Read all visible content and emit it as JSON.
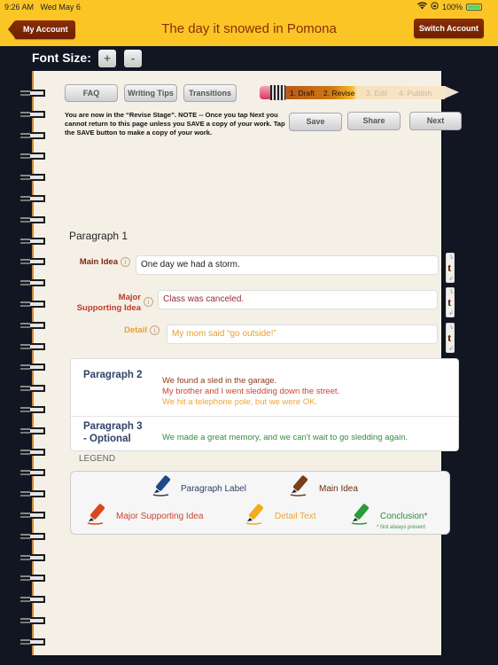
{
  "status_bar": {
    "time": "9:26 AM",
    "date": "Wed May 6",
    "battery": "100%",
    "icons": [
      "wifi-icon",
      "orientation-lock-icon",
      "battery-icon",
      "charging-bolt-icon"
    ]
  },
  "nav": {
    "back_label": "My Account",
    "title": "The day it snowed in Pomona",
    "switch_label": "Switch Account"
  },
  "font_size": {
    "label": "Font Size:",
    "increase": "+",
    "decrease": "-"
  },
  "toolbar": {
    "faq": "FAQ",
    "writing_tips": "Writing Tips",
    "transitions": "Transitions",
    "save": "Save",
    "share": "Share",
    "next": "Next"
  },
  "notice": "You are now in the “Revise Stage”.  NOTE -- Once you tap Next you cannot return to this page unless you SAVE a copy of your work. Tap the SAVE button to make a copy of your work.",
  "progress": {
    "current_stage": 2,
    "total_stages": 4,
    "stages": [
      "1. Draft",
      "2. Revise",
      "3. Edit",
      "4. Publish"
    ]
  },
  "paragraph1": {
    "title": "Paragraph 1",
    "rows": [
      {
        "label": "Main Idea",
        "value": "One day we had a storm.",
        "color": "#7a2a10"
      },
      {
        "label": "Major Supporting Idea",
        "label_line1": "Major",
        "label_line2": "Supporting Idea",
        "value": "Class was canceled.",
        "color": "#c0392b"
      },
      {
        "label": "Detail",
        "value": "My mom said “go outside!”",
        "color": "#e8a030"
      }
    ],
    "transition_button": "t"
  },
  "paragraph2": {
    "label": "Paragraph 2",
    "lines": [
      {
        "text": "We found a sled in the garage.",
        "color": "#8b3a1e"
      },
      {
        "text": "My brother and I went sledding down the street.",
        "color": "#c8452f"
      },
      {
        "text": "We hit a telephone pole, but we were OK.",
        "color": "#eea53a"
      }
    ]
  },
  "paragraph3": {
    "label_line1": "Paragraph 3",
    "label_line2": "- Optional",
    "lines": [
      {
        "text": "We made a great memory, and we can't wait to go sledding again.",
        "color": "#3a8a40"
      }
    ]
  },
  "legend": {
    "title": "LEGEND",
    "items": [
      {
        "label": "Paragraph Label",
        "color": "#2f426a",
        "marker": "#1f4a8a"
      },
      {
        "label": "Main Idea",
        "color": "#6b2e14",
        "marker": "#7a3f1a"
      },
      {
        "label": "Major Supporting Idea",
        "color": "#c8452f",
        "marker": "#d9481c"
      },
      {
        "label": "Detail Text",
        "color": "#eea53a",
        "marker": "#f0ac1c"
      },
      {
        "label": "Conclusion*",
        "color": "#2f8a3e",
        "marker": "#2a9c3a"
      }
    ],
    "note": "* Not always present"
  },
  "colors": {
    "nav_bar": "#fcc526",
    "nav_button": "#7c2704",
    "background": "#111622",
    "paper": "#f4f0e6"
  }
}
